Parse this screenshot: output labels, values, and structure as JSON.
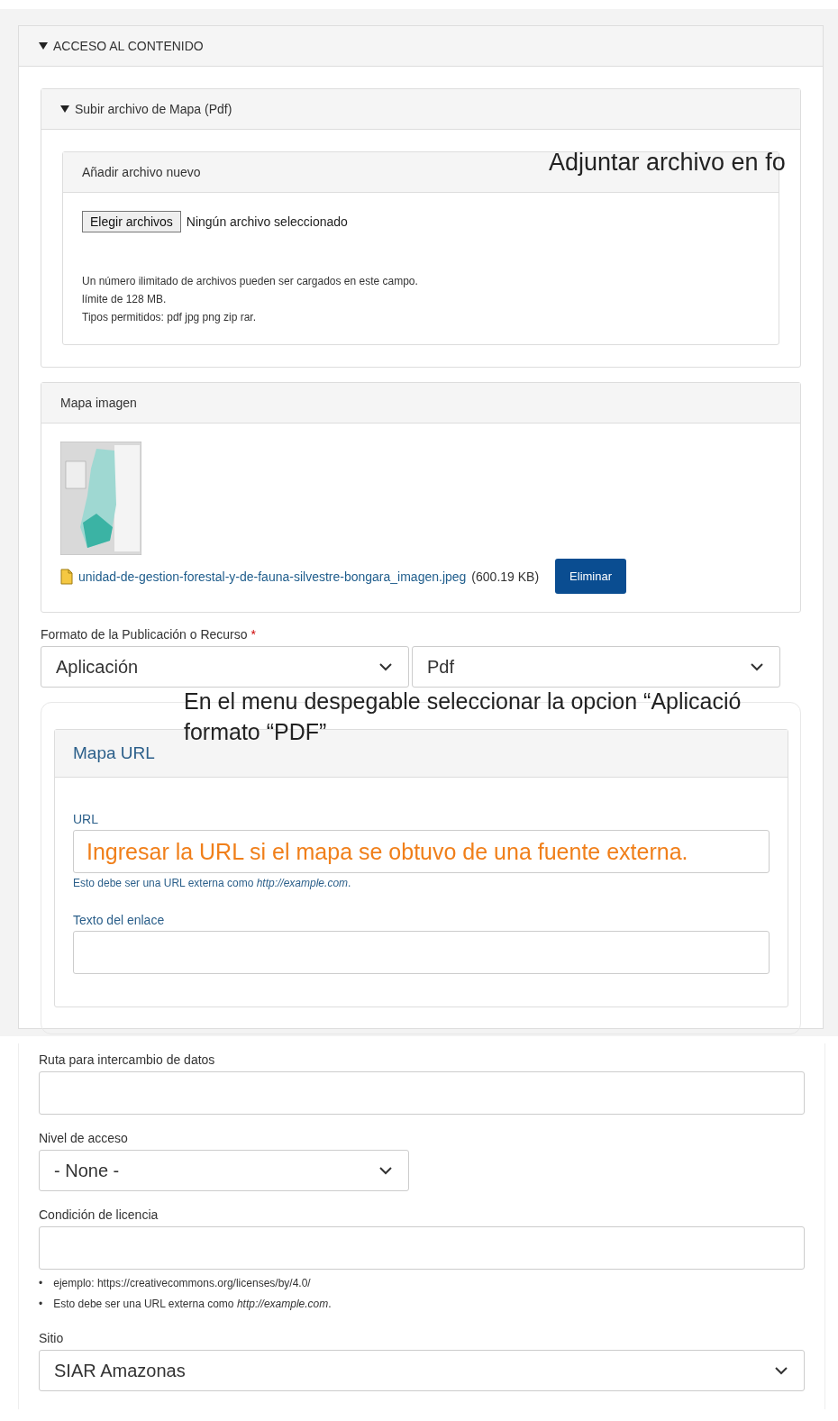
{
  "section": {
    "title": "ACCESO AL CONTENIDO",
    "expanded": true
  },
  "upload_group": {
    "title": "Subir archivo de Mapa (Pdf)",
    "expanded": true
  },
  "new_file": {
    "title": "Añadir archivo nuevo",
    "button": "Elegir archivos",
    "status": "Ningún archivo seleccionado",
    "help": [
      "Un número ilimitado de archivos pueden ser cargados en este campo.",
      "límite de 128 MB.",
      "Tipos permitidos: pdf jpg png zip rar."
    ]
  },
  "map_image": {
    "title": "Mapa imagen",
    "file_link": "unidad-de-gestion-forestal-y-de-fauna-silvestre-bongara_imagen.jpeg",
    "file_size": "(600.19 KB)",
    "remove_button": "Eliminar"
  },
  "format": {
    "label": "Formato de la Publicación o Recurso",
    "required_mark": "*",
    "selects": [
      {
        "value": "Aplicación"
      },
      {
        "value": "Pdf"
      }
    ]
  },
  "map_url": {
    "title": "Mapa URL",
    "url_label": "URL",
    "url_description": "Esto debe ser una URL externa como *http://example.com*.",
    "link_text_label": "Texto del enlace"
  },
  "data_path": {
    "label": "Ruta para intercambio de datos"
  },
  "access_level": {
    "label": "Nivel de acceso",
    "value": "- None -"
  },
  "license": {
    "label": "Condición de licencia",
    "hints": [
      {
        "bullet": "•",
        "text": "ejemplo: https://creativecommons.org/licenses/by/4.0/"
      },
      {
        "bullet": "•",
        "text": "Esto debe ser una URL externa como *http://example.com*."
      }
    ]
  },
  "site": {
    "label": "Sitio",
    "value": "SIAR Amazonas"
  },
  "annotations": [
    {
      "kind": "note",
      "text": "Adjuntar archivo en fo"
    },
    {
      "kind": "note",
      "text": "En el menu despegable seleccionar la opcion “Aplicació\nformato “PDF”"
    },
    {
      "kind": "highlight",
      "text": "Ingresar la URL si el mapa se obtuvo de una fuente externa."
    }
  ]
}
